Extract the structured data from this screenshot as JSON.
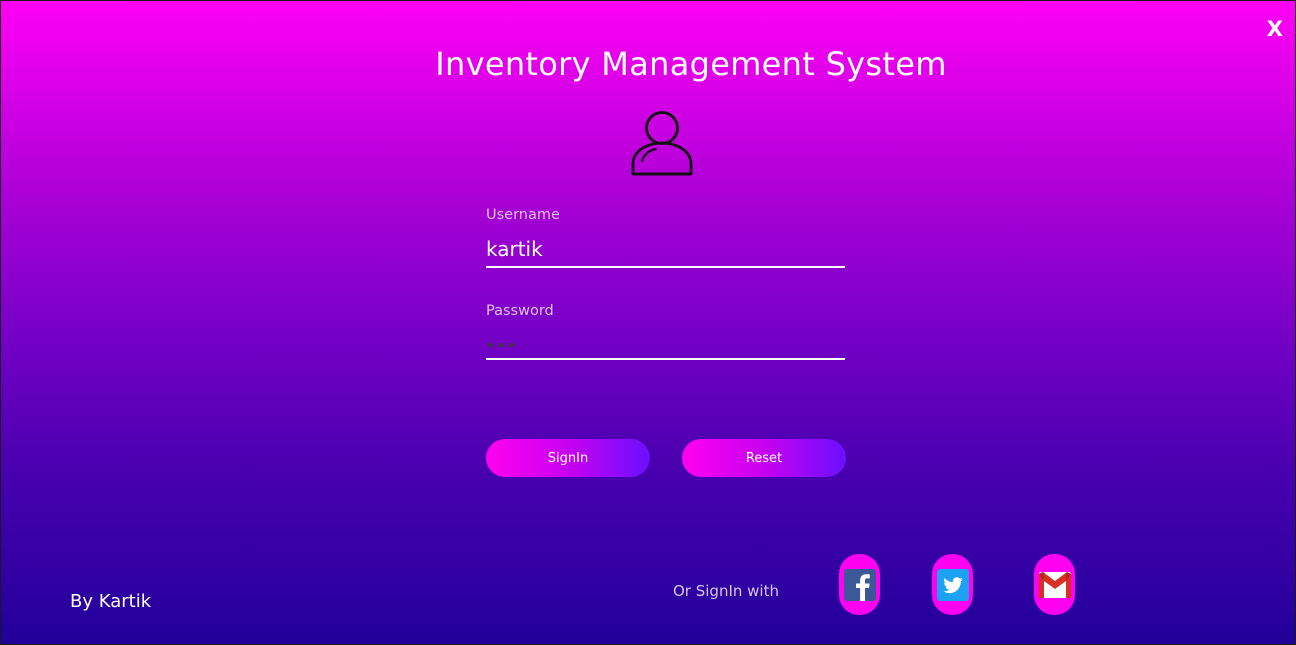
{
  "window": {
    "close_label": "X"
  },
  "header": {
    "title": "Inventory Management System"
  },
  "form": {
    "username_label": "Username",
    "username_value": "kartik",
    "password_label": "Password",
    "password_value": "•••"
  },
  "actions": {
    "signin_label": "SignIn",
    "reset_label": "Reset"
  },
  "footer": {
    "author": "By Kartik",
    "social_prompt": "Or SignIn with",
    "social_icons": [
      "facebook-icon",
      "twitter-icon",
      "gmail-icon"
    ]
  },
  "colors": {
    "gradient_top": "#ff00f5",
    "gradient_bottom": "#22009a",
    "button_start": "#ff00f0",
    "button_end": "#6a10ff",
    "social_bg": "#ff00f0"
  }
}
